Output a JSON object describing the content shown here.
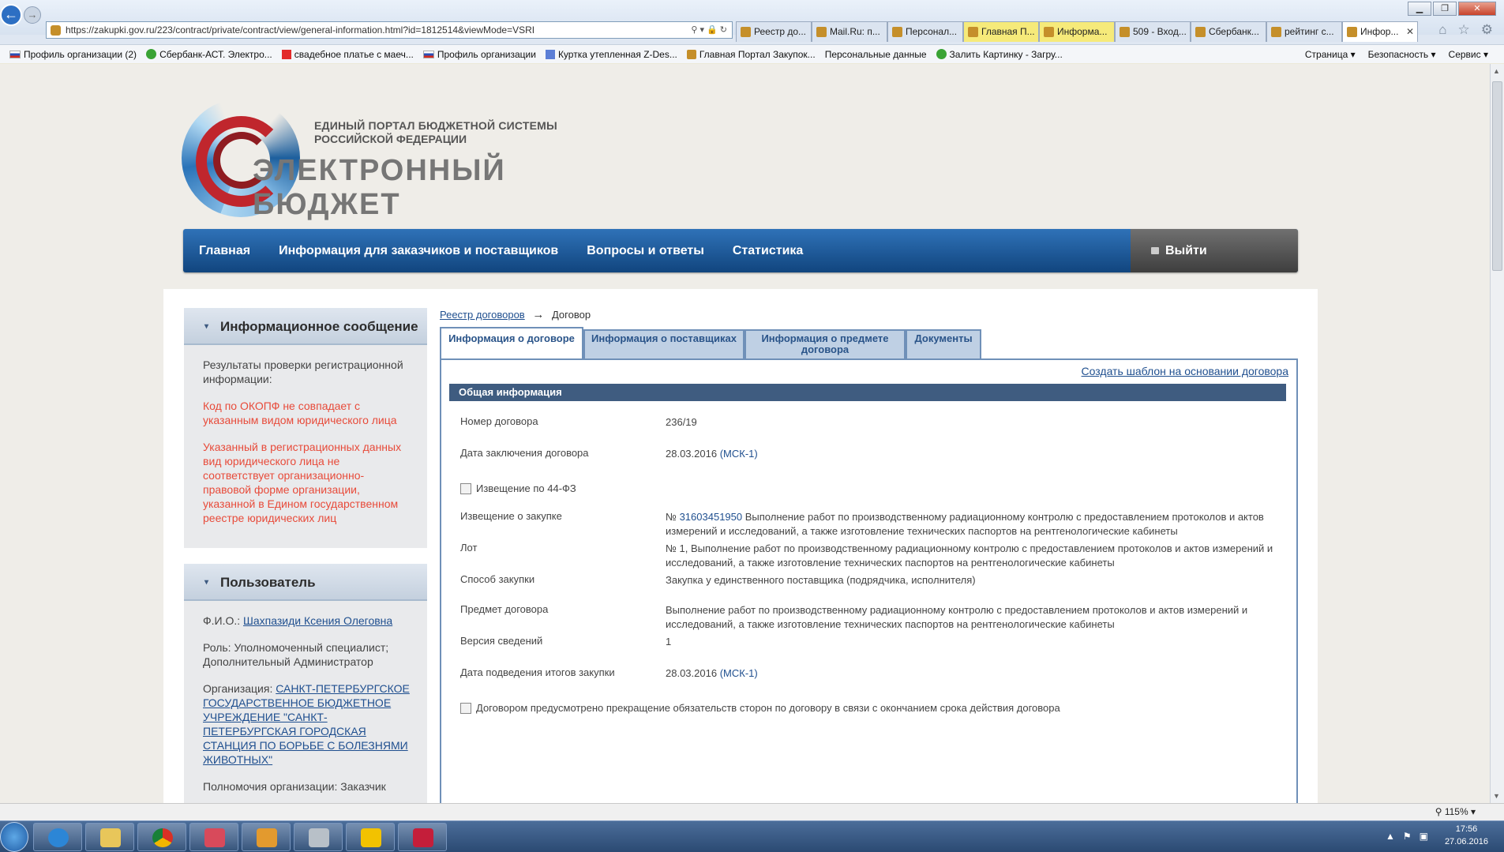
{
  "browser": {
    "url": "https://zakupki.gov.ru/223/contract/private/contract/view/general-information.html?id=1812514&viewMode=VSRI",
    "tabs": [
      {
        "label": "Реестр до...",
        "active": false,
        "highlight": false
      },
      {
        "label": "Mail.Ru: п...",
        "active": false,
        "highlight": false
      },
      {
        "label": "Персонал...",
        "active": false,
        "highlight": false
      },
      {
        "label": "Главная П...",
        "active": false,
        "highlight": true
      },
      {
        "label": "Информа...",
        "active": false,
        "highlight": true
      },
      {
        "label": "509 - Вход...",
        "active": false,
        "highlight": false
      },
      {
        "label": "Сбербанк...",
        "active": false,
        "highlight": false
      },
      {
        "label": "рейтинг с...",
        "active": false,
        "highlight": false
      },
      {
        "label": "Инфор...",
        "active": true,
        "highlight": false
      }
    ],
    "favorites": [
      {
        "label": "Профиль организации (2)",
        "icon": "flag-ru"
      },
      {
        "label": "Сбербанк-АСТ. Электро...",
        "icon": "sberbank"
      },
      {
        "label": "свадебное платье с маеч...",
        "icon": "red-star"
      },
      {
        "label": "Профиль организации",
        "icon": "flag-ru"
      },
      {
        "label": "Куртка утепленная Z-Des...",
        "icon": "blue"
      },
      {
        "label": "Главная Портал Закупок...",
        "icon": "emblem"
      },
      {
        "label": "Персональные данные",
        "icon": "none"
      },
      {
        "label": "Залить Картинку - Загру...",
        "icon": "green"
      }
    ],
    "commands": [
      "Страница ▾",
      "Безопасность ▾",
      "Сервис ▾"
    ],
    "zoom": "115%",
    "clock_time": "17:56",
    "clock_date": "27.06.2016"
  },
  "logo": {
    "line1": "ЕДИНЫЙ ПОРТАЛ БЮДЖЕТНОЙ СИСТЕМЫ",
    "line2": "РОССИЙСКОЙ ФЕДЕРАЦИИ",
    "title": "ЭЛЕКТРОННЫЙ БЮДЖЕТ"
  },
  "nav": {
    "items": [
      "Главная",
      "Информация для заказчиков и поставщиков",
      "Вопросы и ответы",
      "Статистика"
    ],
    "logout": "Выйти"
  },
  "info_message": {
    "title": "Информационное сообщение",
    "intro": "Результаты проверки регистрационной информации:",
    "warning1": "Код по ОКОПФ не совпадает с указанным видом юридического лица",
    "warning2": "Указанный в регистрационных данных вид юридического лица не соответствует организационно-правовой форме организации, указанной в Едином государственном реестре юридических лиц"
  },
  "user": {
    "title": "Пользователь",
    "fio_label": "Ф.И.О.:",
    "fio": "Шахпазиди Ксения Олеговна",
    "role": "Роль: Уполномоченный специалист; Дополнительный Администратор",
    "org_label": "Организация:",
    "org": "САНКТ-ПЕТЕРБУРГСКОЕ ГОСУДАРСТВЕННОЕ БЮДЖЕТНОЕ УЧРЕЖДЕНИЕ \"САНКТ-ПЕТЕРБУРГСКАЯ ГОРОДСКАЯ СТАНЦИЯ ПО БОРЬБЕ С БОЛЕЗНЯМИ ЖИВОТНЫХ\"",
    "authority": "Полномочия организации: Заказчик"
  },
  "breadcrumb": {
    "link": "Реестр договоров",
    "arrow": "→",
    "current": "Договор"
  },
  "tabs": [
    "Информация о договоре",
    "Информация о поставщиках",
    "Информация о предмете договора",
    "Документы"
  ],
  "template_link": "Создать шаблон на основании договора",
  "section_title": "Общая информация",
  "fields": {
    "number_label": "Номер договора",
    "number": "236/19",
    "date_label": "Дата заключения договора",
    "date": "28.03.2016",
    "date_tz": "(МСК-1)",
    "notice44": "Извещение по 44-ФЗ",
    "notice_label": "Извещение о закупке",
    "notice_prefix": "№",
    "notice_number": "31603451950",
    "notice_text": "Выполнение работ по производственному радиационному контролю с предоставлением протоколов и актов измерений и исследований, а также изготовление технических паспортов на рентгенологические кабинеты",
    "lot_label": "Лот",
    "lot": "№ 1, Выполнение работ по производственному радиационному контролю с предоставлением протоколов и актов измерений и исследований, а также изготовление технических паспортов на рентгенологические кабинеты",
    "method_label": "Способ закупки",
    "method": "Закупка у единственного поставщика (подрядчика, исполнителя)",
    "subject_label": "Предмет договора",
    "subject": "Выполнение работ по производственному радиационному контролю с предоставлением протоколов и актов измерений и исследований, а также изготовление технических паспортов на рентгенологические кабинеты",
    "version_label": "Версия сведений",
    "version": "1",
    "result_date_label": "Дата подведения итогов закупки",
    "result_date": "28.03.2016",
    "result_tz": "(МСК-1)",
    "termination": "Договором предусмотрено прекращение обязательств сторон по договору в связи с окончанием срока действия договора"
  }
}
